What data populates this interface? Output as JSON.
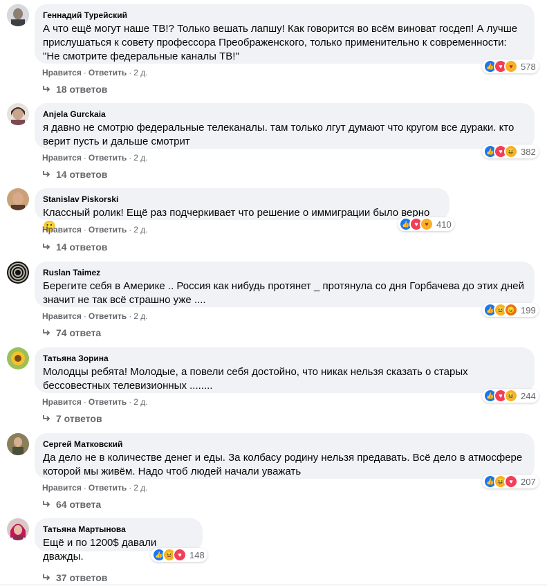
{
  "labels": {
    "like": "Нравится",
    "reply": "Ответить"
  },
  "comments": [
    {
      "author": "Геннадий Турейский",
      "text": "А что ещё могут наше ТВ!? Только вешать лапшу! Как говорится во всём виноват госдеп! А лучше прислушаться к совету профессора Преображенского, только применительно к современности: \"Не смотрите федеральные каналы ТВ!\"",
      "time": "2 д.",
      "reaction_icons": [
        "like-icon",
        "love-icon",
        "care-icon"
      ],
      "reaction_count": "578",
      "replies": "18 ответов"
    },
    {
      "author": "Anjela Gurckaia",
      "text": "я давно не смотрю федеральные телеканалы. там только лгут думают что кругом все дураки. кто верит пусть и дальше смотрит",
      "time": "2 д.",
      "reaction_icons": [
        "like-icon",
        "love-icon",
        "haha-icon"
      ],
      "reaction_count": "382",
      "replies": "14 ответов"
    },
    {
      "author": "Stanislav Piskorski",
      "text": "Классный ролик! Ещё раз подчеркивает что решение о иммиграции было верно🙂",
      "time": "2 д.",
      "reaction_icons": [
        "like-icon",
        "love-icon",
        "care-icon"
      ],
      "reaction_count": "410",
      "replies": "14 ответов"
    },
    {
      "author": "Ruslan Taimez",
      "text": "Берегите себя в Америке .. Россия как нибудь протянет _ протянула со дня Горбачева до этих дней значит не так всё страшно уже ....",
      "time": "2 д.",
      "reaction_icons": [
        "like-icon",
        "haha-icon",
        "angry-icon"
      ],
      "reaction_count": "199",
      "replies": "74 ответа"
    },
    {
      "author": "Татьяна Зорина",
      "text": "Молодцы ребята! Молодые, а повели себя достойно, что никак нельзя сказать о старых бессовестных телевизионных ........",
      "time": "2 д.",
      "reaction_icons": [
        "like-icon",
        "love-icon",
        "haha-icon"
      ],
      "reaction_count": "244",
      "replies": "7 ответов"
    },
    {
      "author": "Сергей Матковский",
      "text": "Да дело не в количестве денег и еды. За колбасу родину нельзя предавать. Всё дело в атмосфере которой мы живём. Надо чтоб людей начали уважать",
      "time": "2 д.",
      "reaction_icons": [
        "like-icon",
        "haha-icon",
        "love-icon"
      ],
      "reaction_count": "207",
      "replies": "64 ответа"
    },
    {
      "author": "Татьяна Мартынова",
      "text": "Ещё и по 1200$ давали дважды.",
      "time": "",
      "reaction_icons": [
        "like-icon",
        "haha-icon",
        "love-icon"
      ],
      "reaction_count": "148",
      "replies": "37 ответов"
    }
  ]
}
